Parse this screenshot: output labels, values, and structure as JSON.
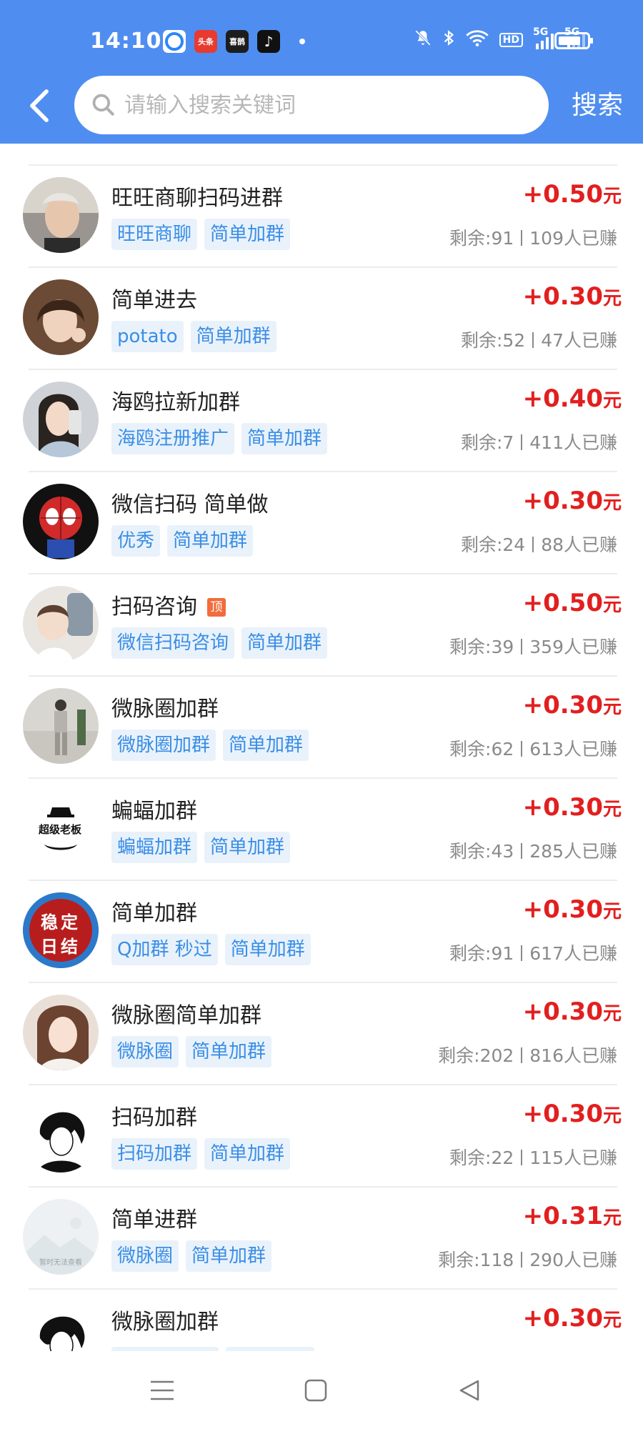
{
  "status_bar": {
    "time": "14:10",
    "app_icons": [
      "头条",
      "喜鹊",
      "♪"
    ],
    "network_badges": [
      "HD",
      "5G",
      "5G"
    ]
  },
  "header": {
    "search_placeholder": "请输入搜索关键词",
    "search_button": "搜索"
  },
  "colors": {
    "header_blue": "#4f8ef0",
    "price_red": "#e21f1f",
    "tag_blue": "#3a8ee6",
    "tag_bg": "#e9f2fb",
    "pin_orange": "#f36c3b"
  },
  "tasks": [
    {
      "title": "旺旺商聊扫码进群",
      "tags": [
        "旺旺商聊",
        "简单加群"
      ],
      "price": "+0.50",
      "unit": "元",
      "remaining": "剩余:91",
      "earned": "109人已赚",
      "pinned": false
    },
    {
      "title": "简单进去",
      "tags": [
        "potato",
        "简单加群"
      ],
      "price": "+0.30",
      "unit": "元",
      "remaining": "剩余:52",
      "earned": "47人已赚",
      "pinned": false
    },
    {
      "title": "海鸥拉新加群",
      "tags": [
        "海鸥注册推广",
        "简单加群"
      ],
      "price": "+0.40",
      "unit": "元",
      "remaining": "剩余:7",
      "earned": "411人已赚",
      "pinned": false
    },
    {
      "title": "微信扫码 简单做",
      "tags": [
        "优秀",
        "简单加群"
      ],
      "price": "+0.30",
      "unit": "元",
      "remaining": "剩余:24",
      "earned": "88人已赚",
      "pinned": false
    },
    {
      "title": "扫码咨询",
      "pin_label": "顶",
      "tags": [
        "微信扫码咨询",
        "简单加群"
      ],
      "price": "+0.50",
      "unit": "元",
      "remaining": "剩余:39",
      "earned": "359人已赚",
      "pinned": true
    },
    {
      "title": "微脉圈加群",
      "tags": [
        "微脉圈加群",
        "简单加群"
      ],
      "price": "+0.30",
      "unit": "元",
      "remaining": "剩余:62",
      "earned": "613人已赚",
      "pinned": false
    },
    {
      "title": "蝙蝠加群",
      "tags": [
        "蝙蝠加群",
        "简单加群"
      ],
      "price": "+0.30",
      "unit": "元",
      "remaining": "剩余:43",
      "earned": "285人已赚",
      "pinned": false,
      "avatar_text": "超级老板"
    },
    {
      "title": "简单加群",
      "tags": [
        "Q加群 秒过",
        "简单加群"
      ],
      "price": "+0.30",
      "unit": "元",
      "remaining": "剩余:91",
      "earned": "617人已赚",
      "pinned": false,
      "avatar_text": [
        "稳定",
        "日结"
      ]
    },
    {
      "title": "微脉圈简单加群",
      "tags": [
        "微脉圈",
        "简单加群"
      ],
      "price": "+0.30",
      "unit": "元",
      "remaining": "剩余:202",
      "earned": "816人已赚",
      "pinned": false
    },
    {
      "title": "扫码加群",
      "tags": [
        "扫码加群",
        "简单加群"
      ],
      "price": "+0.30",
      "unit": "元",
      "remaining": "剩余:22",
      "earned": "115人已赚",
      "pinned": false
    },
    {
      "title": "简单进群",
      "tags": [
        "微脉圈",
        "简单加群"
      ],
      "price": "+0.31",
      "unit": "元",
      "remaining": "剩余:118",
      "earned": "290人已赚",
      "pinned": false,
      "avatar_text": "暂时无法查看"
    },
    {
      "title": "微脉圈加群",
      "tags": [],
      "price": "+0.30",
      "unit": "元",
      "remaining": "",
      "earned": "",
      "pinned": false
    }
  ]
}
